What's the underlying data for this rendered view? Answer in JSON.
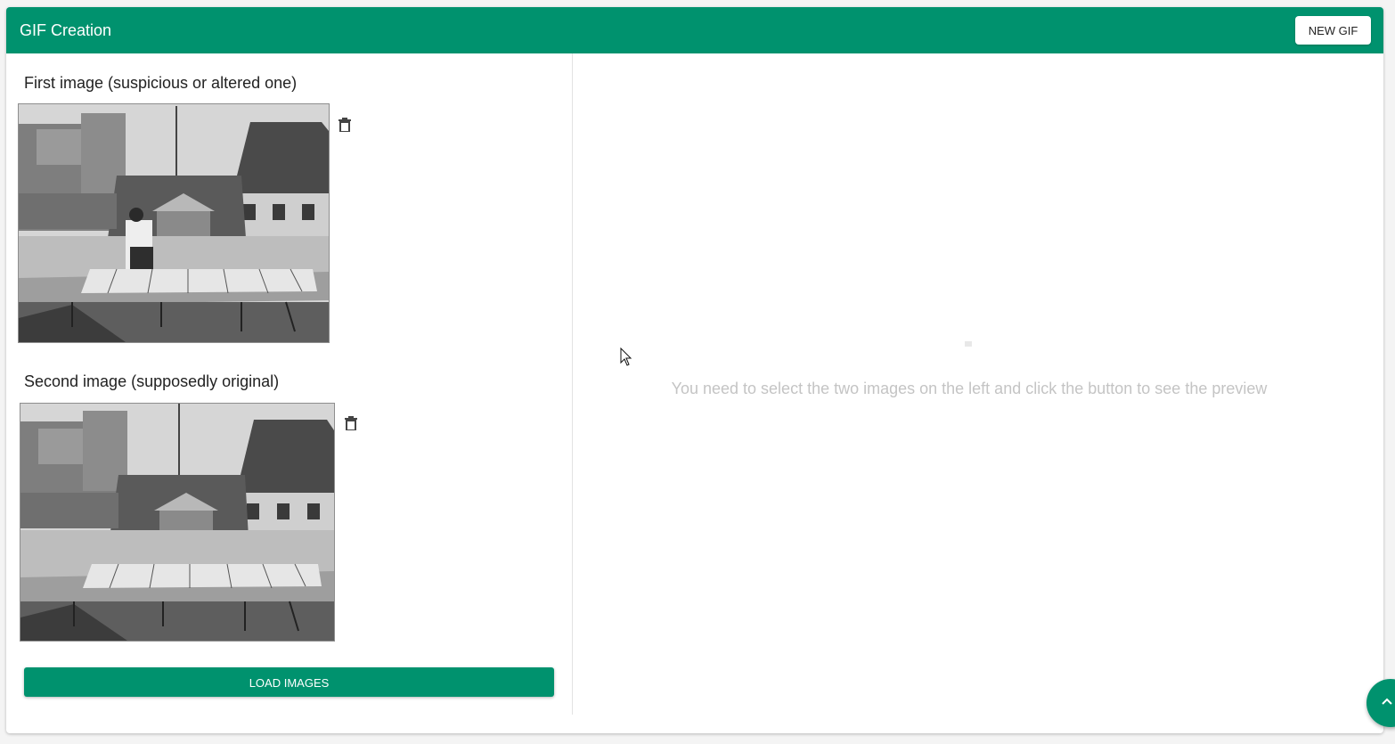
{
  "appbar": {
    "title": "GIF Creation",
    "new_gif_label": "NEW GIF"
  },
  "left": {
    "first_image_label": "First image (suspicious or altered one)",
    "second_image_label": "Second image (supposedly original)",
    "load_button_label": "LOAD IMAGES",
    "delete_icon": "trash-icon"
  },
  "right": {
    "placeholder_text": "You need to select the two images on the left and click the button to see the preview"
  },
  "colors": {
    "accent": "#00926e",
    "placeholder_text": "#c4c4c4"
  },
  "scroll_top_icon": "chevron-up-icon"
}
